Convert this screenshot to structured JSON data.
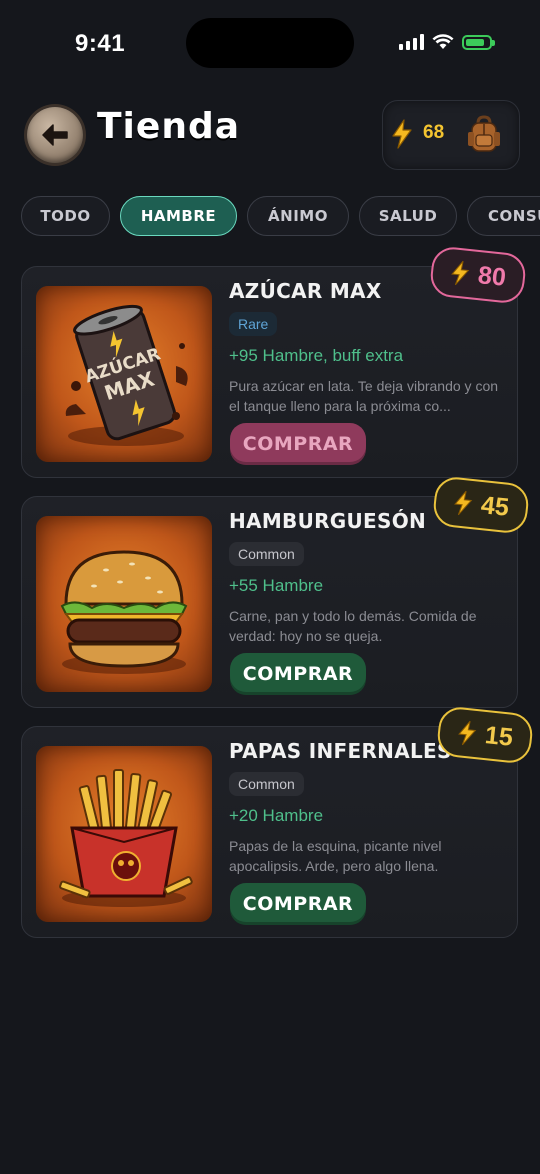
{
  "status_bar": {
    "time": "9:41"
  },
  "header": {
    "title": "Tienda",
    "energy": "68",
    "icons": {
      "back": "arrow-left-icon",
      "energy": "lightning-bolt-icon",
      "inventory": "backpack-icon"
    }
  },
  "tabs": [
    {
      "label": "TODO",
      "active": false
    },
    {
      "label": "HAMBRE",
      "active": true
    },
    {
      "label": "ÁNIMO",
      "active": false
    },
    {
      "label": "SALUD",
      "active": false
    },
    {
      "label": "CONSU",
      "active": false
    }
  ],
  "items": [
    {
      "name": "AZÚCAR MAX",
      "rarity": "Rare",
      "effect": "+95 Hambre, buff extra",
      "description": "Pura azúcar en lata. Te deja vibrando y con el tanque lleno para la próxima co...",
      "price": "80",
      "button": "COMPRAR",
      "can_label": "AZÚCAR MAX"
    },
    {
      "name": "HAMBURGUESÓN",
      "rarity": "Common",
      "effect": "+55 Hambre",
      "description": "Carne, pan y todo lo demás. Comida de verdad: hoy no se queja.",
      "price": "45",
      "button": "COMPRAR"
    },
    {
      "name": "PAPAS INFERNALES",
      "rarity": "Common",
      "effect": "+20 Hambre",
      "description": "Papas de la esquina, picante nivel apocalipsis. Arde, pero algo llena.",
      "price": "15",
      "button": "COMPRAR"
    }
  ],
  "colors": {
    "background": "#15171c",
    "accent_teal": "#6ad9bf",
    "energy_gold": "#f4c430",
    "price_pink": "#e3689b",
    "buy_green": "#1f5a3a"
  }
}
